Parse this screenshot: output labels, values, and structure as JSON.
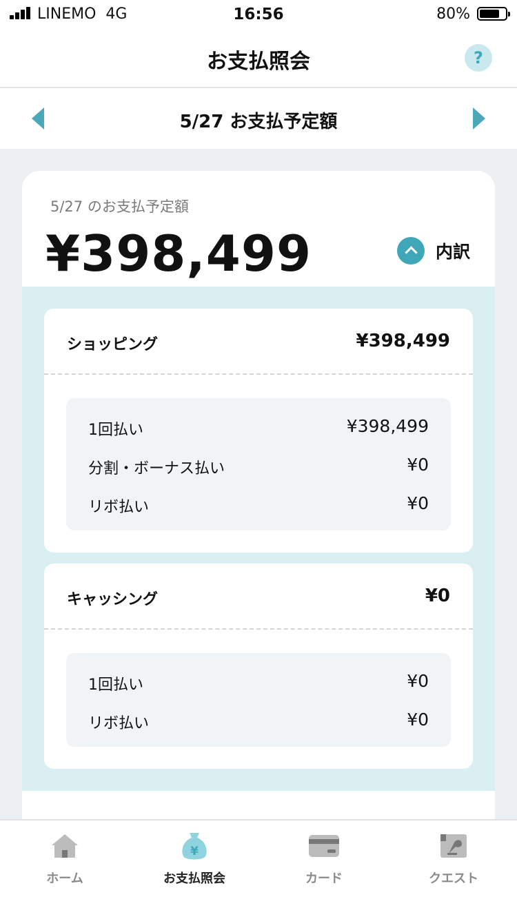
{
  "status_bar": {
    "carrier": "LINEMO",
    "network": "4G",
    "time": "16:56",
    "battery": "80%"
  },
  "header": {
    "title": "お支払照会",
    "help_label": "?"
  },
  "date_nav": {
    "title": "5/27 お支払予定額"
  },
  "summary": {
    "label": "5/27 のお支払予定額",
    "amount": "¥398,499",
    "breakdown_label": "内訳"
  },
  "sections": [
    {
      "name": "ショッピング",
      "total": "¥398,499",
      "rows": [
        {
          "label": "1回払い",
          "value": "¥398,499"
        },
        {
          "label": "分割・ボーナス払い",
          "value": "¥0"
        },
        {
          "label": "リボ払い",
          "value": "¥0"
        }
      ]
    },
    {
      "name": "キャッシング",
      "total": "¥0",
      "rows": [
        {
          "label": "1回払い",
          "value": "¥0"
        },
        {
          "label": "リボ払い",
          "value": "¥0"
        }
      ]
    }
  ],
  "tabs": [
    {
      "label": "ホーム",
      "icon": "home-icon"
    },
    {
      "label": "お支払照会",
      "icon": "yen-bag-icon"
    },
    {
      "label": "カード",
      "icon": "card-icon"
    },
    {
      "label": "クエスト",
      "icon": "quest-scroll-icon"
    }
  ],
  "colors": {
    "accent": "#3fa7b8",
    "panel": "#d9eff2",
    "active_tab": "#222222",
    "inactive_tab": "#8a8a8a"
  }
}
